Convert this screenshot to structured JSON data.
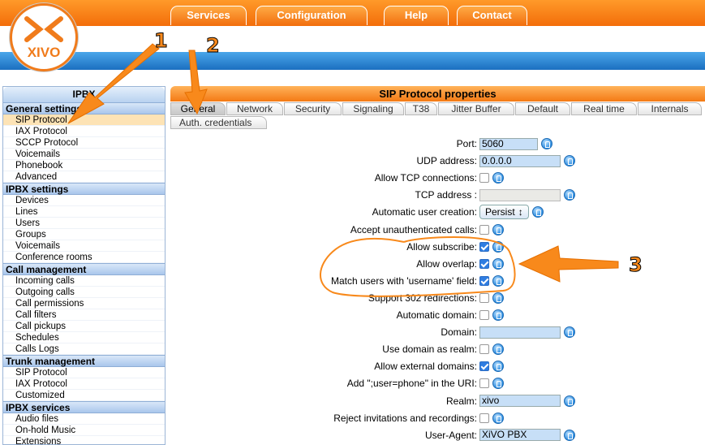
{
  "header": {
    "nav": [
      "Services",
      "Configuration",
      "Help",
      "Contact"
    ],
    "logo_text": "XIVO"
  },
  "sidebar": {
    "title": "IPBX",
    "sections": [
      {
        "title": "General settings",
        "items": [
          "SIP Protocol",
          "IAX Protocol",
          "SCCP Protocol",
          "Voicemails",
          "Phonebook",
          "Advanced"
        ]
      },
      {
        "title": "IPBX settings",
        "items": [
          "Devices",
          "Lines",
          "Users",
          "Groups",
          "Voicemails",
          "Conference rooms"
        ]
      },
      {
        "title": "Call management",
        "items": [
          "Incoming calls",
          "Outgoing calls",
          "Call permissions",
          "Call filters",
          "Call pickups",
          "Schedules",
          "Calls Logs"
        ]
      },
      {
        "title": "Trunk management",
        "items": [
          "SIP Protocol",
          "IAX Protocol",
          "Customized"
        ]
      },
      {
        "title": "IPBX services",
        "items": [
          "Audio files",
          "On-hold Music",
          "Extensions"
        ]
      }
    ]
  },
  "main": {
    "title": "SIP Protocol properties",
    "tabs": [
      "General",
      "Network",
      "Security",
      "Signaling",
      "T38",
      "Jitter Buffer",
      "Default",
      "Real time",
      "Internals"
    ],
    "tab_row2": "Auth. credentials",
    "fields": [
      {
        "label": "Port:",
        "type": "text",
        "value": "5060"
      },
      {
        "label": "UDP address:",
        "type": "text",
        "value": "0.0.0.0",
        "wide": true
      },
      {
        "label": "Allow TCP connections:",
        "type": "checkbox",
        "checked": false
      },
      {
        "label": "TCP address :",
        "type": "text",
        "value": "",
        "wide": true,
        "disabled": true
      },
      {
        "label": "Automatic user creation:",
        "type": "select",
        "value": "Persist"
      },
      {
        "label": "Accept unauthenticated calls:",
        "type": "checkbox",
        "checked": false
      },
      {
        "label": "Allow subscribe:",
        "type": "checkbox",
        "checked": true
      },
      {
        "label": "Allow overlap:",
        "type": "checkbox",
        "checked": true
      },
      {
        "label": "Match users with 'username' field:",
        "type": "checkbox",
        "checked": true
      },
      {
        "label": "Support 302 redirections:",
        "type": "checkbox",
        "checked": false
      },
      {
        "label": "Automatic domain:",
        "type": "checkbox",
        "checked": false
      },
      {
        "label": "Domain:",
        "type": "text",
        "value": "",
        "wide": true
      },
      {
        "label": "Use domain as realm:",
        "type": "checkbox",
        "checked": false
      },
      {
        "label": "Allow external domains:",
        "type": "checkbox",
        "checked": true
      },
      {
        "label": "Add \";user=phone\" in the URI:",
        "type": "checkbox",
        "checked": false
      },
      {
        "label": "Realm:",
        "type": "text",
        "value": "xivo",
        "wide": true
      },
      {
        "label": "Reject invitations and recordings:",
        "type": "checkbox",
        "checked": false
      },
      {
        "label": "User-Agent:",
        "type": "text",
        "value": "XiVO PBX",
        "wide": true
      }
    ]
  },
  "annotations": [
    "1",
    "2",
    "3"
  ],
  "colors": {
    "accent": "#f8891b",
    "nav_orange": "#f36d0a",
    "band_blue": "#1b6fc0",
    "field_blue": "#c7dff7"
  }
}
